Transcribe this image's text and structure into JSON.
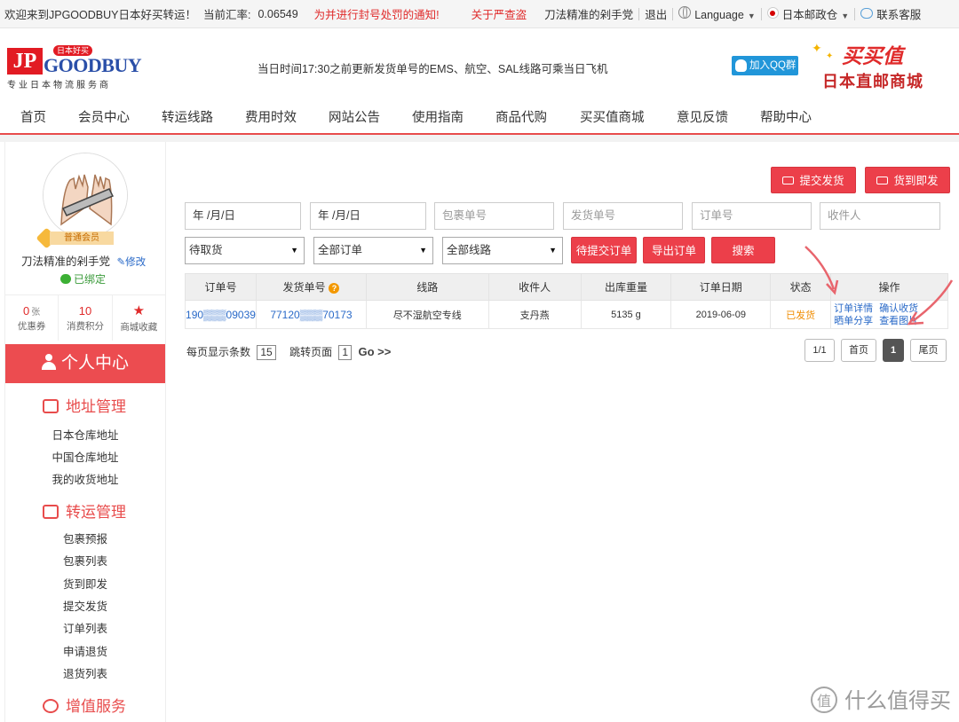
{
  "topbar": {
    "welcome": "欢迎来到JPGOODBUY日本好买转运！",
    "rate_label": "当前汇率:",
    "rate_value": "0.06549",
    "notice1": "为并进行封号处罚的通知!",
    "notice2": "关于严查盗",
    "username": "刀法精准的剁手党",
    "logout": "退出",
    "language": "Language",
    "post": "日本邮政仓",
    "service": "联系客服"
  },
  "header": {
    "logo_jp": "JP",
    "logo_goodbuy": "GOODBUY",
    "logo_badge": "日本好买",
    "slogan": "专业日本物流服务商",
    "notice": "当日时间17:30之前更新发货单号的EMS、航空、SAL线路可乘当日飞机",
    "qq_label": "加入QQ群",
    "promo_title": "买买值",
    "promo_sub": "日本直邮商城"
  },
  "nav": [
    "首页",
    "会员中心",
    "转运线路",
    "费用时效",
    "网站公告",
    "使用指南",
    "商品代购",
    "买买值商城",
    "意见反馈",
    "帮助中心"
  ],
  "sidebar": {
    "member_level": "普通会员",
    "username": "刀法精准的剁手党",
    "edit": "修改",
    "bound": "已绑定",
    "stats": [
      {
        "num": "0",
        "unit": "张",
        "label": "优惠券"
      },
      {
        "num": "10",
        "unit": "",
        "label": "消费积分"
      },
      {
        "num": "",
        "unit": "",
        "label": "商城收藏"
      }
    ],
    "personal_center": "个人中心",
    "sections": [
      {
        "title": "地址管理",
        "items": [
          "日本仓库地址",
          "中国仓库地址",
          "我的收货地址"
        ]
      },
      {
        "title": "转运管理",
        "items": [
          "包裹预报",
          "包裹列表",
          "货到即发",
          "提交发货",
          "订单列表",
          "申请退货",
          "退货列表"
        ]
      },
      {
        "title": "增值服务",
        "items": []
      }
    ]
  },
  "main": {
    "btn_submit": "提交发货",
    "btn_arrive": "货到即发",
    "date_from_placeholder": "年 /月/日",
    "date_to_placeholder": "年 /月/日",
    "pkg_placeholder": "包裹单号",
    "ship_placeholder": "发货单号",
    "order_placeholder": "订单号",
    "recipient_placeholder": "收件人",
    "select_status": "待取货",
    "select_orders": "全部订单",
    "select_routes": "全部线路",
    "btn_pending": "待提交订单",
    "btn_export": "导出订单",
    "btn_search": "搜索",
    "table": {
      "headers": [
        "订单号",
        "发货单号",
        "线路",
        "收件人",
        "出库重量",
        "订单日期",
        "状态",
        "操作"
      ],
      "rows": [
        {
          "order_no": "190▒▒▒09039",
          "ship_no": "77120▒▒▒70173",
          "route": "尽不湿航空专线",
          "recipient": "支丹燕",
          "weight": "5135 g",
          "date": "2019-06-09",
          "status": "已发货",
          "ops": [
            "订单详情",
            "确认收货",
            "晒单分享",
            "查看图片"
          ]
        }
      ]
    },
    "pager": {
      "per_page_label": "每页显示条数",
      "per_page": "15",
      "jump_label": "跳转页面",
      "jump_page": "1",
      "go": "Go >>",
      "ratio": "1/1",
      "first": "首页",
      "current": "1",
      "last": "尾页"
    }
  },
  "watermark": "什么值得买"
}
